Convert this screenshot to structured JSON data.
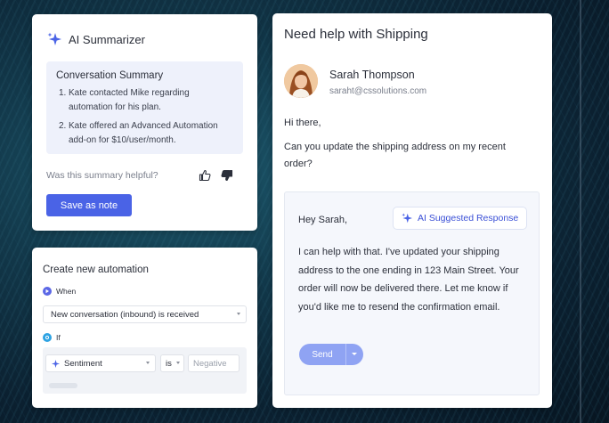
{
  "summarizer": {
    "title": "AI Summarizer",
    "summary_title": "Conversation Summary",
    "items": [
      {
        "num": "1.",
        "text": "Kate contacted Mike regarding automation for his plan."
      },
      {
        "num": "2.",
        "text": "Kate offered an Advanced Automation add-on for $10/user/month."
      }
    ],
    "helpful_prompt": "Was this summary helpful?",
    "save_label": "Save as note"
  },
  "automation": {
    "title": "Create new automation",
    "when_label": "When",
    "when_value": "New conversation (inbound) is received",
    "if_label": "If",
    "condition": {
      "field": "Sentiment",
      "operator": "is",
      "value_placeholder": "Negative"
    }
  },
  "ticket": {
    "title": "Need help with Shipping",
    "customer_name": "Sarah Thompson",
    "customer_email": "saraht@cssolutions.com",
    "greeting": "Hi there,",
    "message": "Can you update the shipping address on my recent order?",
    "response": {
      "greeting": "Hey Sarah,",
      "badge": "AI Suggested Response",
      "body": "I can help with that. I've updated your shipping address to the one ending in 123 Main Street. Your order will now be delivered there. Let me know if you'd like me to resend the confirmation email.",
      "send_label": "Send"
    }
  },
  "colors": {
    "accent": "#4a63e6",
    "accent_light": "#8fa3f3",
    "summary_bg": "#eef1fb",
    "badge_text": "#3a4fd6"
  }
}
